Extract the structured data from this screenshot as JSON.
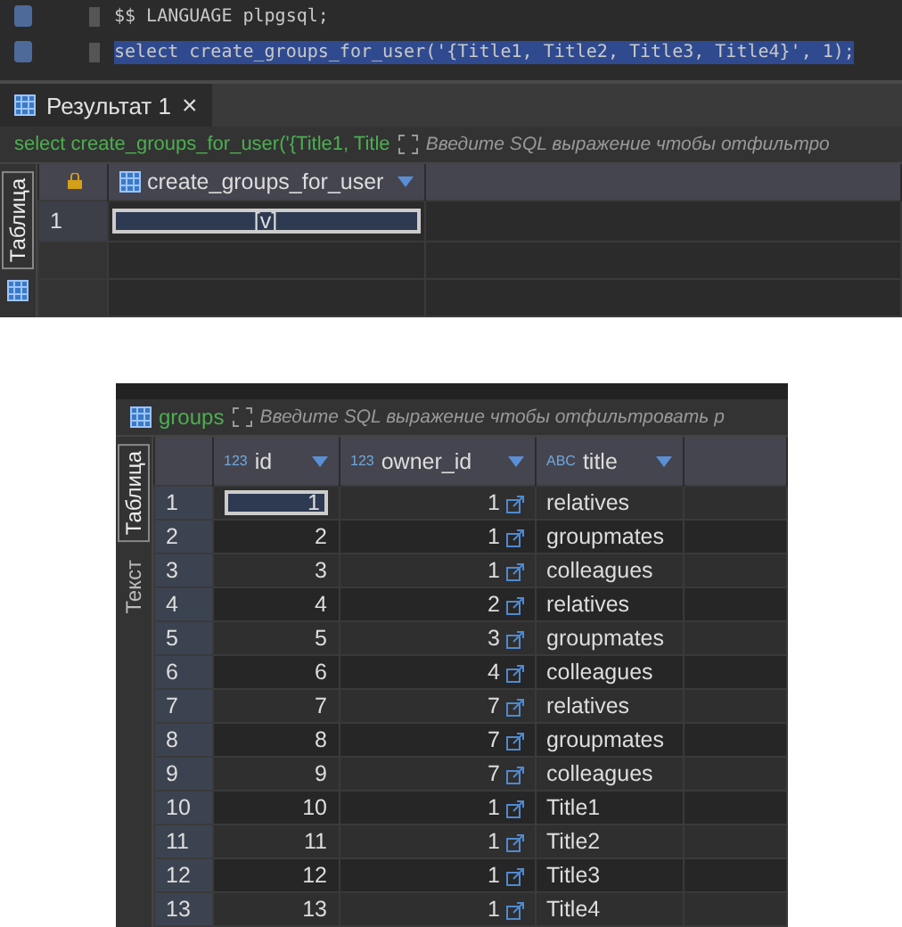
{
  "editor": {
    "lines": [
      {
        "text": "$$ LANGUAGE plpgsql;",
        "selected": false
      },
      {
        "text": "select create_groups_for_user('{Title1, Title2, Title3, Title4}', 1);",
        "selected": true
      }
    ]
  },
  "result_panel": {
    "tabs": [
      {
        "label": "Результат 1",
        "close": "×",
        "selected": true
      }
    ],
    "query": "select create_groups_for_user('{Title1, Title",
    "filter": {
      "placeholder": "Введите SQL выражение чтобы отфильтро"
    },
    "side_tabs": [
      {
        "label": "Таблица",
        "selected": true
      }
    ],
    "columns": [
      {
        "name": "create_groups_for_user"
      }
    ],
    "rows": [
      {
        "num": "1",
        "cells": [
          "[v]"
        ]
      }
    ]
  },
  "groups_panel": {
    "table": "groups",
    "filter": {
      "placeholder": "Введите SQL выражение чтобы отфильтровать р"
    },
    "side_tabs": [
      {
        "label": "Таблица",
        "selected": true
      },
      {
        "label": "Текст",
        "selected": false
      }
    ],
    "columns": [
      {
        "name": "id",
        "type": "123"
      },
      {
        "name": "owner_id",
        "type": "123"
      },
      {
        "name": "title",
        "type": "ABC"
      }
    ],
    "rows": [
      {
        "num": "1",
        "id": "1",
        "owner_id": "1",
        "title": "relatives"
      },
      {
        "num": "2",
        "id": "2",
        "owner_id": "1",
        "title": "groupmates"
      },
      {
        "num": "3",
        "id": "3",
        "owner_id": "1",
        "title": "colleagues"
      },
      {
        "num": "4",
        "id": "4",
        "owner_id": "2",
        "title": "relatives"
      },
      {
        "num": "5",
        "id": "5",
        "owner_id": "3",
        "title": "groupmates"
      },
      {
        "num": "6",
        "id": "6",
        "owner_id": "4",
        "title": "colleagues"
      },
      {
        "num": "7",
        "id": "7",
        "owner_id": "7",
        "title": "relatives"
      },
      {
        "num": "8",
        "id": "8",
        "owner_id": "7",
        "title": "groupmates"
      },
      {
        "num": "9",
        "id": "9",
        "owner_id": "7",
        "title": "colleagues"
      },
      {
        "num": "10",
        "id": "10",
        "owner_id": "1",
        "title": "Title1"
      },
      {
        "num": "11",
        "id": "11",
        "owner_id": "1",
        "title": "Title2"
      },
      {
        "num": "12",
        "id": "12",
        "owner_id": "1",
        "title": "Title3"
      },
      {
        "num": "13",
        "id": "13",
        "owner_id": "1",
        "title": "Title4"
      }
    ]
  }
}
